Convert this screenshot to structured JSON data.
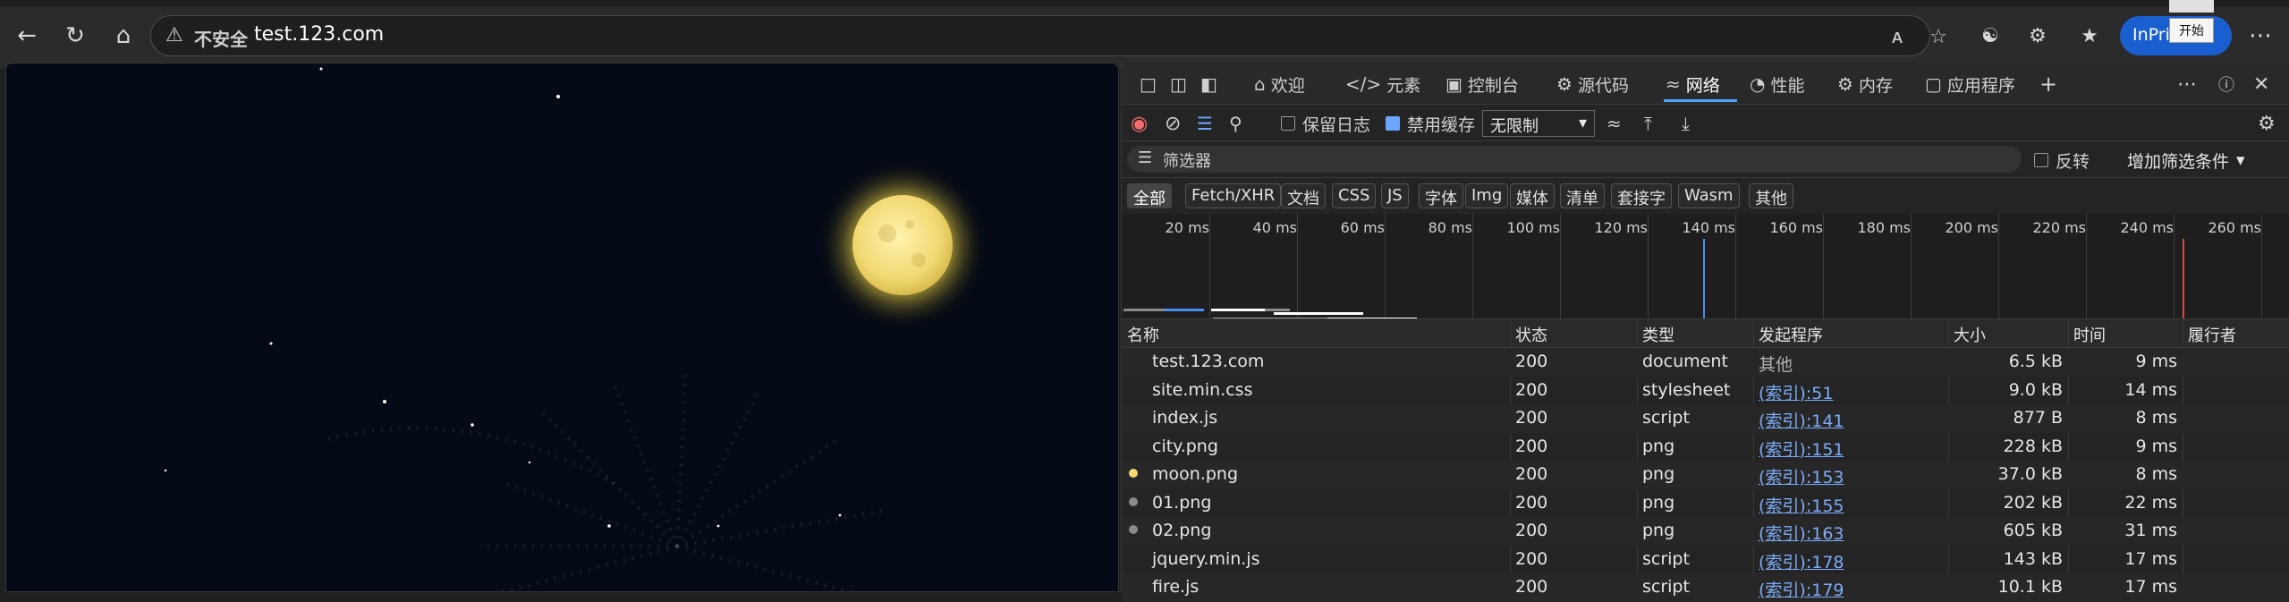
{
  "browser": {
    "address": {
      "insecure_label": "不安全",
      "url": "test.123.com"
    },
    "inprivate_label": "InPriv",
    "tooltip_label": "开始"
  },
  "devtools": {
    "tabs": [
      {
        "label": "欢迎",
        "icon": "home-icon"
      },
      {
        "label": "元素",
        "icon": "code-icon"
      },
      {
        "label": "控制台",
        "icon": "console-icon"
      },
      {
        "label": "源代码",
        "icon": "bug-icon"
      },
      {
        "label": "网络",
        "icon": "wifi-icon"
      },
      {
        "label": "性能",
        "icon": "gauge-icon"
      },
      {
        "label": "内存",
        "icon": "memory-icon"
      },
      {
        "label": "应用程序",
        "icon": "app-icon"
      }
    ],
    "toolbar": {
      "preserve_log": "保留日志",
      "disable_cache": "禁用缓存",
      "throttle": "无限制"
    },
    "filter": {
      "placeholder": "筛选器",
      "invert": "反转",
      "more_filters": "增加筛选条件"
    },
    "chips": [
      "全部",
      "Fetch/XHR",
      "文档",
      "CSS",
      "JS",
      "字体",
      "Img",
      "媒体",
      "清单",
      "套接字",
      "Wasm",
      "其他"
    ],
    "overview_ticks": [
      "20 ms",
      "40 ms",
      "60 ms",
      "80 ms",
      "100 ms",
      "120 ms",
      "140 ms",
      "160 ms",
      "180 ms",
      "200 ms",
      "220 ms",
      "240 ms",
      "260 ms"
    ],
    "columns": [
      "名称",
      "状态",
      "类型",
      "发起程序",
      "大小",
      "时间",
      "履行者"
    ],
    "rows": [
      {
        "name": "test.123.com",
        "status": "200",
        "type": "document",
        "initiator": "其他",
        "initiator_link": false,
        "size": "6.5 kB",
        "time": "9 ms",
        "icon": ""
      },
      {
        "name": "site.min.css",
        "status": "200",
        "type": "stylesheet",
        "initiator": "(索引):51",
        "initiator_link": true,
        "size": "9.0 kB",
        "time": "14 ms",
        "icon": ""
      },
      {
        "name": "index.js",
        "status": "200",
        "type": "script",
        "initiator": "(索引):141",
        "initiator_link": true,
        "size": "877 B",
        "time": "8 ms",
        "icon": ""
      },
      {
        "name": "city.png",
        "status": "200",
        "type": "png",
        "initiator": "(索引):151",
        "initiator_link": true,
        "size": "228 kB",
        "time": "9 ms",
        "icon": ""
      },
      {
        "name": "moon.png",
        "status": "200",
        "type": "png",
        "initiator": "(索引):153",
        "initiator_link": true,
        "size": "37.0 kB",
        "time": "8 ms",
        "icon": "moon-thumb-icon"
      },
      {
        "name": "01.png",
        "status": "200",
        "type": "png",
        "initiator": "(索引):155",
        "initiator_link": true,
        "size": "202 kB",
        "time": "22 ms",
        "icon": "image-thumb-icon"
      },
      {
        "name": "02.png",
        "status": "200",
        "type": "png",
        "initiator": "(索引):163",
        "initiator_link": true,
        "size": "605 kB",
        "time": "31 ms",
        "icon": "image-thumb-icon"
      },
      {
        "name": "jquery.min.js",
        "status": "200",
        "type": "script",
        "initiator": "(索引):178",
        "initiator_link": true,
        "size": "143 kB",
        "time": "17 ms",
        "icon": ""
      },
      {
        "name": "fire.js",
        "status": "200",
        "type": "script",
        "initiator": "(索引):179",
        "initiator_link": true,
        "size": "10.1 kB",
        "time": "17 ms",
        "icon": ""
      }
    ]
  }
}
